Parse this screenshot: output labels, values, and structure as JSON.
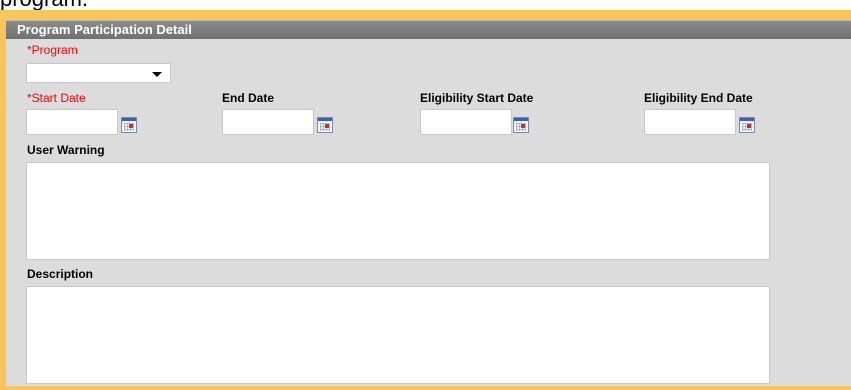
{
  "page": {
    "clipped_text": "program."
  },
  "panel": {
    "title": "Program Participation Detail",
    "program_label": "*Program",
    "program_value": "",
    "start_date_label": "*Start Date",
    "end_date_label": "End Date",
    "elig_start_label": "Eligibility Start Date",
    "elig_end_label": "Eligibility End Date",
    "user_warning_label": "User Warning",
    "description_label": "Description"
  },
  "colors": {
    "frame": "#fbc55c",
    "panel_bg": "#dcdcdc",
    "header_bg": "#808080",
    "required": "#ff0000"
  },
  "icons": {
    "date_picker": "calendar-icon",
    "dropdown": "chevron-down-icon"
  }
}
